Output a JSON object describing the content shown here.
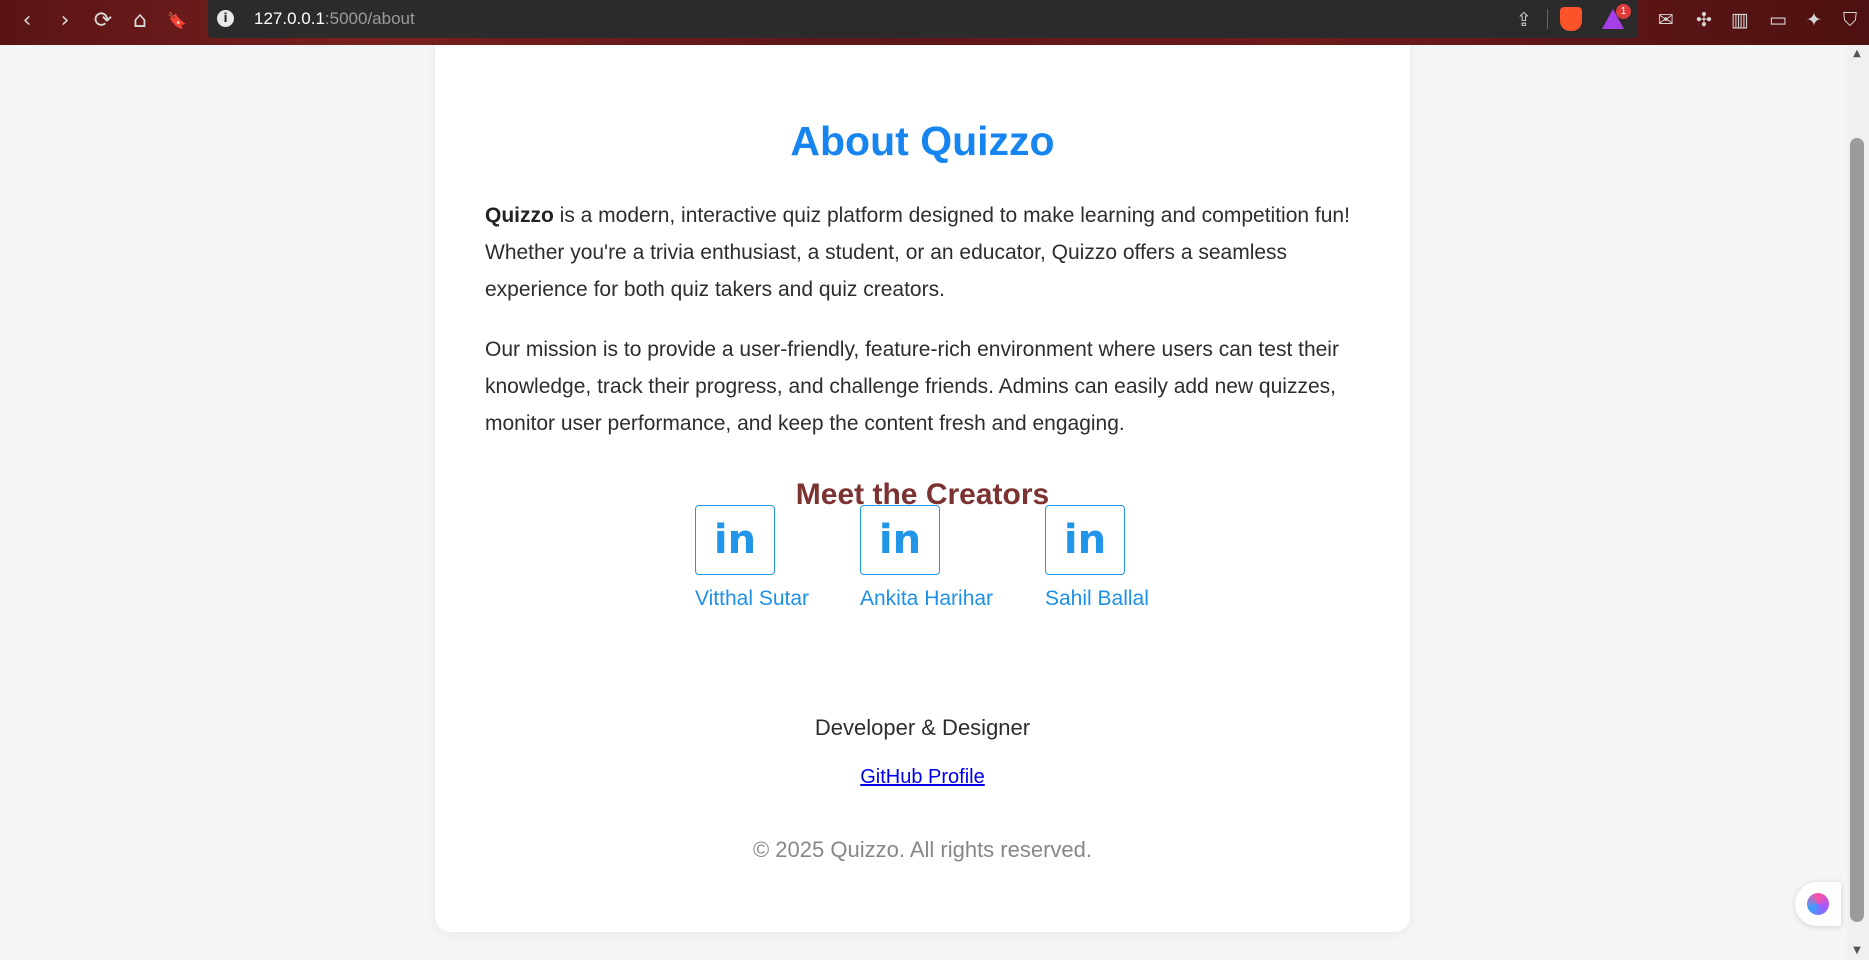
{
  "browser": {
    "url_host": "127.0.0.1",
    "url_path": ":5000/about",
    "rewards_badge": "1",
    "nav": {
      "back": "‹",
      "forward": "›",
      "reload": "⟳",
      "home": "⌂",
      "bookmark": "🔖"
    }
  },
  "page": {
    "title": "About Quizzo",
    "intro_brand": "Quizzo",
    "intro_text": " is a modern, interactive quiz platform designed to make learning and competition fun! Whether you're a trivia enthusiast, a student, or an educator, Quizzo offers a seamless experience for both quiz takers and quiz creators.",
    "mission_text": "Our mission is to provide a user-friendly, feature-rich environment where users can test their knowledge, track their progress, and challenge friends. Admins can easily add new quizzes, monitor user performance, and keep the content fresh and engaging.",
    "creators_heading": "Meet the Creators",
    "creators": [
      {
        "icon": "in",
        "name": "Vitthal Sutar"
      },
      {
        "icon": "in",
        "name": "Ankita Harihar"
      },
      {
        "icon": "in",
        "name": "Sahil Ballal"
      }
    ],
    "role": "Developer & Designer",
    "github_link": "GitHub Profile",
    "copyright": "© 2025 Quizzo. All rights reserved."
  },
  "colors": {
    "title": "#1785f0",
    "subheading": "#7b3231",
    "link": "#1e90e6"
  }
}
